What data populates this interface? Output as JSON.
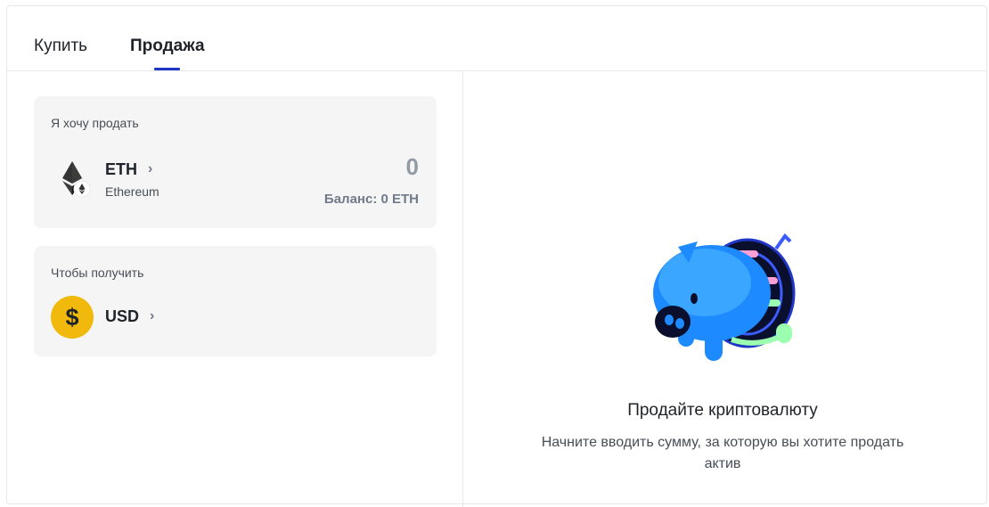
{
  "tabs": {
    "buy_label": "Купить",
    "sell_label": "Продажа",
    "active": "sell"
  },
  "sell_card": {
    "label": "Я хочу продать",
    "coin_symbol": "ETH",
    "coin_name": "Ethereum",
    "coin_icon": "ethereum-icon",
    "amount": "0",
    "balance": "Баланс: 0 ETH"
  },
  "receive_card": {
    "label": "Чтобы получить",
    "coin_symbol": "USD",
    "coin_icon": "dollar-coin-icon"
  },
  "empty_state": {
    "illustration": "piggy-bank-icon",
    "title": "Продайте криптовалюту",
    "description": "Начните вводить сумму, за которую вы хотите продать актив"
  },
  "colors": {
    "accent": "#1f36c7",
    "card_bg": "#f5f5f5",
    "dollar_coin": "#f0b90b"
  }
}
